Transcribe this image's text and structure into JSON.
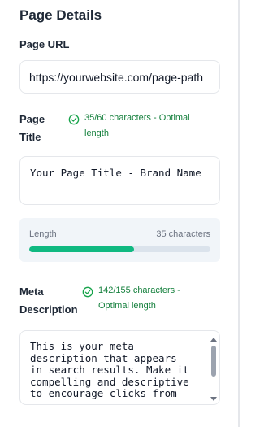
{
  "panel": {
    "title": "Page Details"
  },
  "url_field": {
    "label": "Page URL",
    "value": "https://yourwebsite.com/page-path"
  },
  "title_field": {
    "label_line1": "Page",
    "label_line2": "Title",
    "status_line1": "35/60 characters - Optimal",
    "status_line2": "length",
    "value": "Your Page Title - Brand Name"
  },
  "length_meter": {
    "label": "Length",
    "count_text": "35 characters",
    "fill_fraction": 0.58,
    "fill_color": "#10b981"
  },
  "meta_field": {
    "label_line1": "Meta",
    "label_line2": "Description",
    "status_line1": "142/155 characters -",
    "status_line2": "Optimal length",
    "value_lines": [
      "This is your meta",
      "description that appears",
      "in search results. Make it",
      "compelling and descriptive",
      "to encourage clicks from"
    ]
  },
  "colors": {
    "status_green": "#15803d",
    "check_icon": "check-circle-icon"
  }
}
